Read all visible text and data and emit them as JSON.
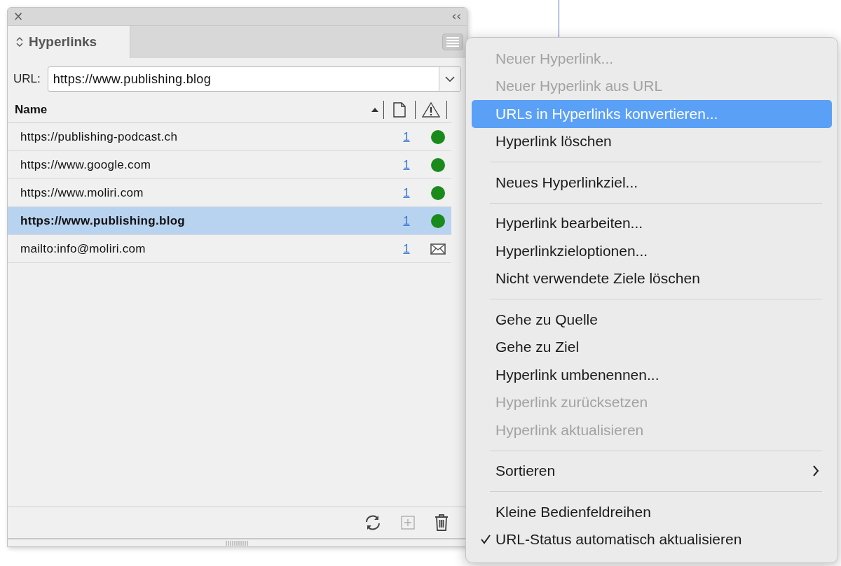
{
  "panel": {
    "close": "×",
    "collapse": "‹‹",
    "tab": {
      "label": "Hyperlinks",
      "selected": true
    },
    "url": {
      "label": "URL:",
      "value": "https://www.publishing.blog"
    },
    "columns": [
      {
        "label": "Name"
      }
    ],
    "rows": [
      {
        "kind": "web",
        "name": "https://publishing-podcast.ch",
        "page": "1",
        "selected": false
      },
      {
        "kind": "web",
        "name": "https://www.google.com",
        "page": "1",
        "selected": false
      },
      {
        "kind": "web",
        "name": "https://www.moliri.com",
        "page": "1",
        "selected": false
      },
      {
        "kind": "web",
        "name": "https://www.publishing.blog",
        "page": "1",
        "selected": true
      },
      {
        "kind": "mail",
        "name": "mailto:info@moliri.com",
        "page": "1",
        "selected": false
      }
    ]
  },
  "menu": [
    {
      "kind": "item",
      "label": "Neuer Hyperlink...",
      "disabled": true,
      "selected": false,
      "checked": false
    },
    {
      "kind": "item",
      "label": "Neuer Hyperlink aus URL",
      "disabled": true,
      "selected": false,
      "checked": false
    },
    {
      "kind": "item",
      "label": "URLs in Hyperlinks konvertieren...",
      "disabled": false,
      "selected": true,
      "checked": false
    },
    {
      "kind": "item",
      "label": "Hyperlink löschen",
      "disabled": false,
      "selected": false,
      "checked": false
    },
    {
      "kind": "separator"
    },
    {
      "kind": "item",
      "label": "Neues Hyperlinkziel...",
      "disabled": false,
      "selected": false,
      "checked": false
    },
    {
      "kind": "separator"
    },
    {
      "kind": "item",
      "label": "Hyperlink bearbeiten...",
      "disabled": false,
      "selected": false,
      "checked": false
    },
    {
      "kind": "item",
      "label": "Hyperlinkzieloptionen...",
      "disabled": false,
      "selected": false,
      "checked": false
    },
    {
      "kind": "item",
      "label": "Nicht verwendete Ziele löschen",
      "disabled": false,
      "selected": false,
      "checked": false
    },
    {
      "kind": "separator"
    },
    {
      "kind": "item",
      "label": "Gehe zu Quelle",
      "disabled": false,
      "selected": false,
      "checked": false
    },
    {
      "kind": "item",
      "label": "Gehe zu Ziel",
      "disabled": false,
      "selected": false,
      "checked": false
    },
    {
      "kind": "item",
      "label": "Hyperlink umbenennen...",
      "disabled": false,
      "selected": false,
      "checked": false
    },
    {
      "kind": "item",
      "label": "Hyperlink zurücksetzen",
      "disabled": true,
      "selected": false,
      "checked": false
    },
    {
      "kind": "item",
      "label": "Hyperlink aktualisieren",
      "disabled": true,
      "selected": false,
      "checked": false
    },
    {
      "kind": "separator"
    },
    {
      "kind": "submenu",
      "label": "Sortieren",
      "disabled": false,
      "selected": false,
      "checked": false
    },
    {
      "kind": "separator"
    },
    {
      "kind": "item",
      "label": "Kleine Bedienfeldreihen",
      "disabled": false,
      "selected": false,
      "checked": false
    },
    {
      "kind": "item",
      "label": "URL-Status automatisch aktualisieren",
      "disabled": false,
      "selected": false,
      "checked": true
    }
  ]
}
